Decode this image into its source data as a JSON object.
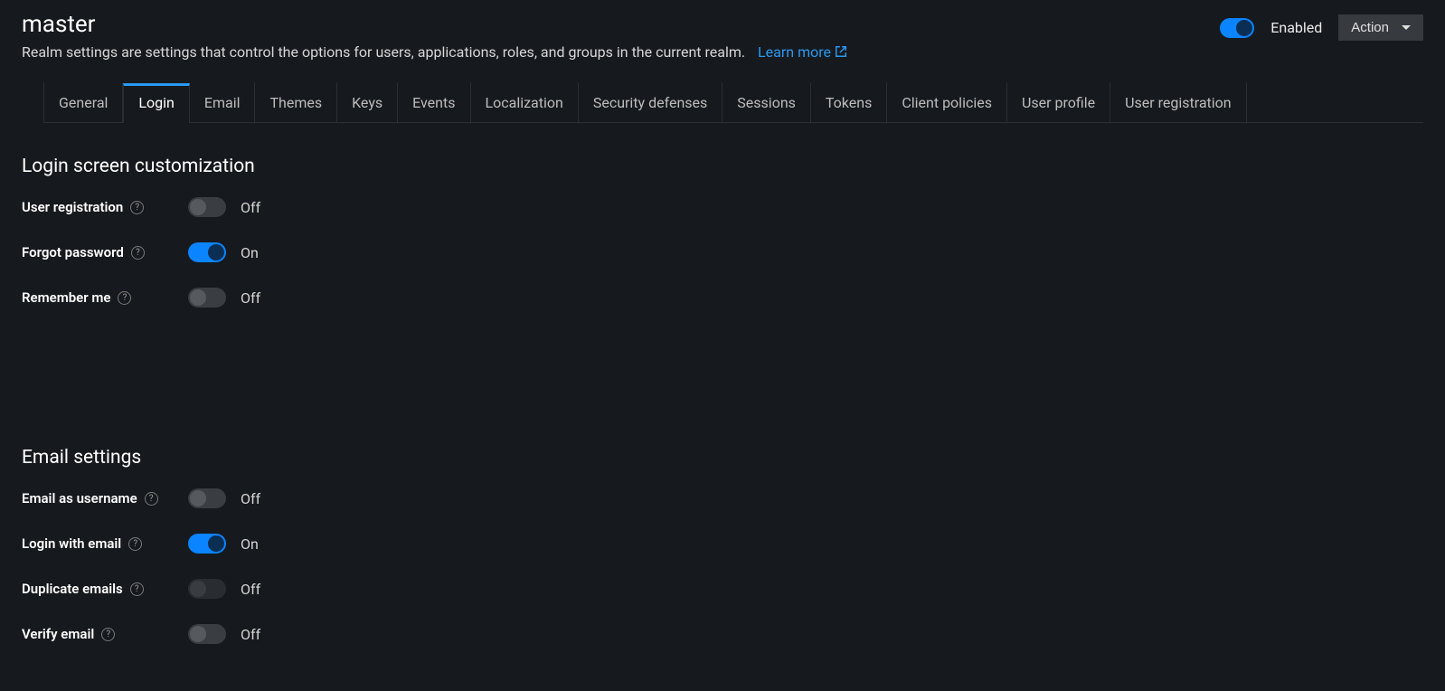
{
  "header": {
    "title": "master",
    "description": "Realm settings are settings that control the options for users, applications, roles, and groups in the current realm.",
    "learn_more": "Learn more",
    "enabled_label": "Enabled",
    "enabled_on": true,
    "action_label": "Action"
  },
  "tabs": [
    {
      "label": "General",
      "active": false
    },
    {
      "label": "Login",
      "active": true
    },
    {
      "label": "Email",
      "active": false
    },
    {
      "label": "Themes",
      "active": false
    },
    {
      "label": "Keys",
      "active": false
    },
    {
      "label": "Events",
      "active": false
    },
    {
      "label": "Localization",
      "active": false
    },
    {
      "label": "Security defenses",
      "active": false
    },
    {
      "label": "Sessions",
      "active": false
    },
    {
      "label": "Tokens",
      "active": false
    },
    {
      "label": "Client policies",
      "active": false
    },
    {
      "label": "User profile",
      "active": false
    },
    {
      "label": "User registration",
      "active": false
    }
  ],
  "status_text": {
    "on": "On",
    "off": "Off"
  },
  "sections": [
    {
      "title": "Login screen customization",
      "items": [
        {
          "label": "User registration",
          "on": false,
          "disabled": false
        },
        {
          "label": "Forgot password",
          "on": true,
          "disabled": false
        },
        {
          "label": "Remember me",
          "on": false,
          "disabled": false
        }
      ]
    },
    {
      "title": "Email settings",
      "items": [
        {
          "label": "Email as username",
          "on": false,
          "disabled": false
        },
        {
          "label": "Login with email",
          "on": true,
          "disabled": false
        },
        {
          "label": "Duplicate emails",
          "on": false,
          "disabled": true
        },
        {
          "label": "Verify email",
          "on": false,
          "disabled": false
        }
      ]
    }
  ]
}
